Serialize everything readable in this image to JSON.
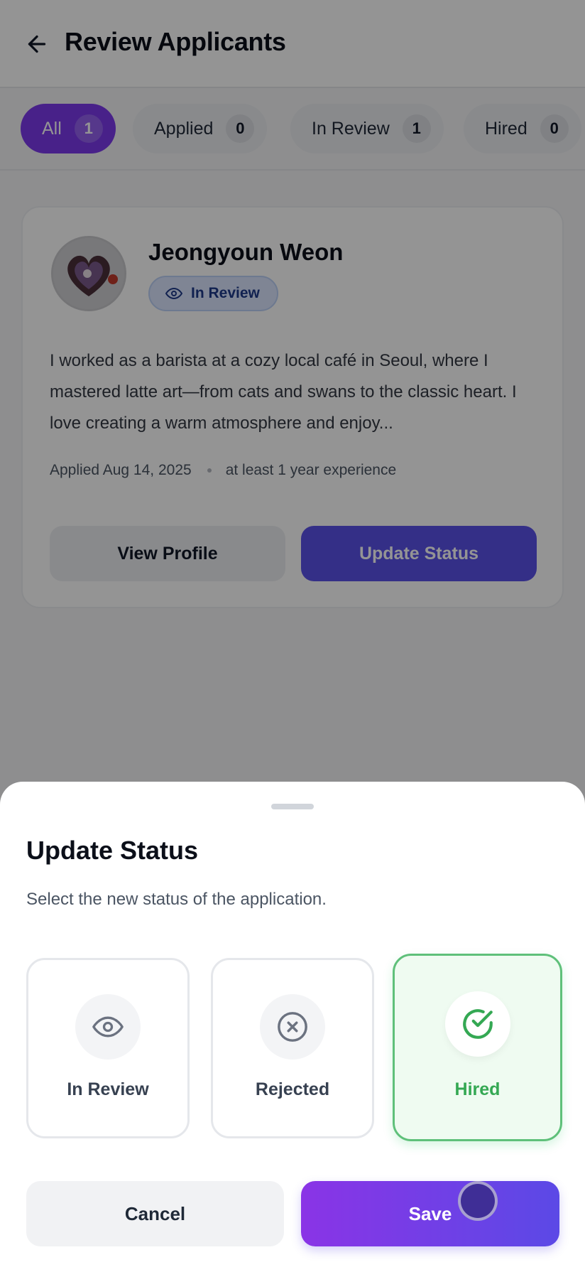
{
  "header": {
    "title": "Review Applicants"
  },
  "tabs": [
    {
      "label": "All",
      "count": "1",
      "active": true
    },
    {
      "label": "Applied",
      "count": "0"
    },
    {
      "label": "In Review",
      "count": "1"
    },
    {
      "label": "Hired",
      "count": "0"
    }
  ],
  "applicant": {
    "name": "Jeongyoun Weon",
    "status": "In Review",
    "bio": "I worked as a barista at a cozy local café in Seoul, where I mastered latte art—from cats and swans to the classic heart. I love creating a warm atmosphere and enjoy...",
    "applied": "Applied Aug 14, 2025",
    "experience": "at least 1 year experience",
    "view_label": "View Profile",
    "update_label": "Update Status"
  },
  "sheet": {
    "title": "Update Status",
    "subtitle": "Select the new status of the application.",
    "options": [
      {
        "label": "In Review",
        "icon": "eye-icon"
      },
      {
        "label": "Rejected",
        "icon": "x-circle-icon"
      },
      {
        "label": "Hired",
        "icon": "check-circle-icon",
        "selected": true
      }
    ],
    "cancel_label": "Cancel",
    "save_label": "Save"
  },
  "colors": {
    "accent": "#7c3aed",
    "save_gradient_start": "#8a34e6",
    "save_gradient_end": "#5b49e6",
    "hired_green": "#34a853",
    "in_review_blue": "#1e3a8a"
  }
}
